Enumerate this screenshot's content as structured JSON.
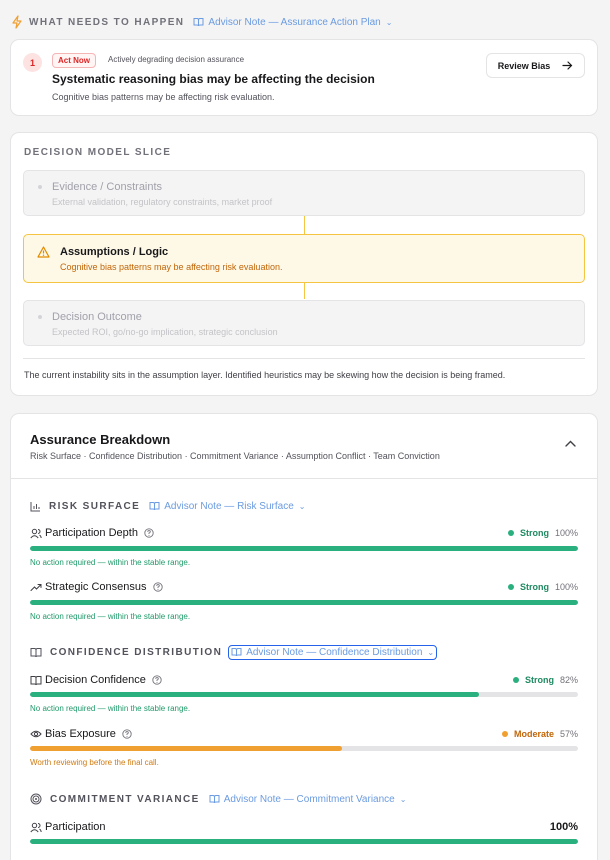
{
  "header": {
    "title": "What Needs to Happen",
    "advisor_note": "Advisor Note — Assurance Action Plan"
  },
  "action_card": {
    "number": "1",
    "badge": "Act Now",
    "badge_sub": "Actively degrading decision assurance",
    "title": "Systematic reasoning bias may be affecting the decision",
    "description": "Cognitive bias patterns may be affecting risk evaluation.",
    "button_label": "Review Bias"
  },
  "decision_model": {
    "title": "Decision Model Slice",
    "layers": [
      {
        "title": "Evidence / Constraints",
        "subtitle": "External validation, regulatory constraints, market proof"
      },
      {
        "title": "Assumptions / Logic",
        "subtitle": "Cognitive bias patterns may be affecting risk evaluation."
      },
      {
        "title": "Decision Outcome",
        "subtitle": "Expected ROI, go/no-go implication, strategic conclusion"
      }
    ],
    "footer": "The current instability sits in the assumption layer. Identified heuristics may be skewing how the decision is being framed."
  },
  "assurance": {
    "title": "Assurance Breakdown",
    "subtitle": "Risk Surface · Confidence Distribution · Commitment Variance · Assumption Conflict · Team Conviction",
    "groups": [
      {
        "title": "Risk Surface",
        "advisor_note": "Advisor Note — Risk Surface",
        "metrics": [
          {
            "label": "Participation Depth",
            "status": "Strong",
            "value": "100%",
            "level": 100,
            "note": "No action required — within the stable range."
          },
          {
            "label": "Strategic Consensus",
            "status": "Strong",
            "value": "100%",
            "level": 100,
            "note": "No action required — within the stable range."
          }
        ]
      },
      {
        "title": "Confidence Distribution",
        "advisor_note": "Advisor Note — Confidence Distribution",
        "metrics": [
          {
            "label": "Decision Confidence",
            "status": "Strong",
            "value": "82%",
            "level": 82,
            "note": "No action required — within the stable range."
          },
          {
            "label": "Bias Exposure",
            "status": "Moderate",
            "value": "57%",
            "level": 57,
            "note": "Worth reviewing before the final call."
          }
        ]
      },
      {
        "title": "Commitment Variance",
        "advisor_note": "Advisor Note — Commitment Variance",
        "metrics": [
          {
            "label": "Participation",
            "value": "100%",
            "level": 100
          }
        ]
      }
    ]
  },
  "colors": {
    "strong": "#2ab07f",
    "moderate": "#f0a030",
    "moderate_text": "#c2660a",
    "alert": "#dc2626",
    "link": "#6b9be0"
  }
}
